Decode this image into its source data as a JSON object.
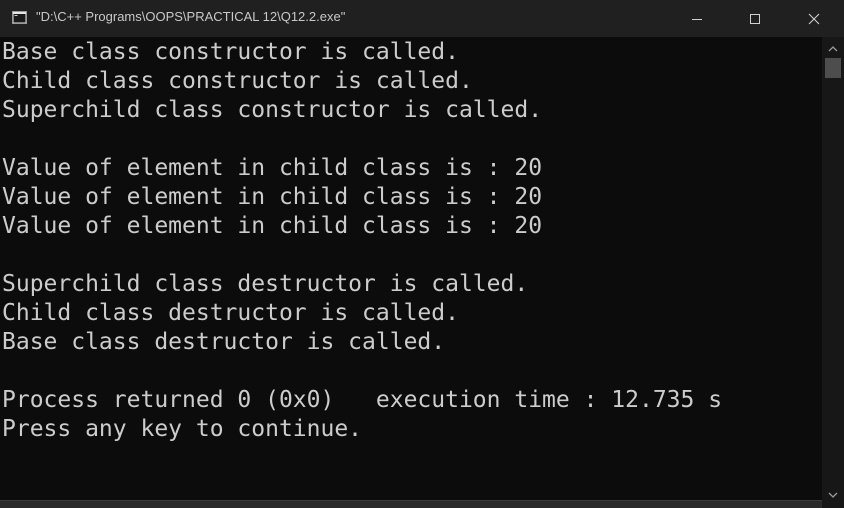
{
  "window": {
    "title": "\"D:\\C++ Programs\\OOPS\\PRACTICAL 12\\Q12.2.exe\"",
    "icon": "console-app-icon",
    "buttons": [
      "minimize-icon",
      "maximize-icon",
      "close-icon"
    ]
  },
  "console": {
    "text_color": "#cccccc",
    "background": "#0c0c0c",
    "lines": [
      "Base class constructor is called.",
      "Child class constructor is called.",
      "Superchild class constructor is called.",
      "",
      "Value of element in child class is : 20",
      "Value of element in child class is : 20",
      "Value of element in child class is : 20",
      "",
      "Superchild class destructor is called.",
      "Child class destructor is called.",
      "Base class destructor is called.",
      "",
      "Process returned 0 (0x0)   execution time : 12.735 s",
      "Press any key to continue."
    ]
  },
  "scrollbar": {
    "icons": [
      "scroll-up-arrow-icon",
      "scroll-down-arrow-icon"
    ]
  }
}
